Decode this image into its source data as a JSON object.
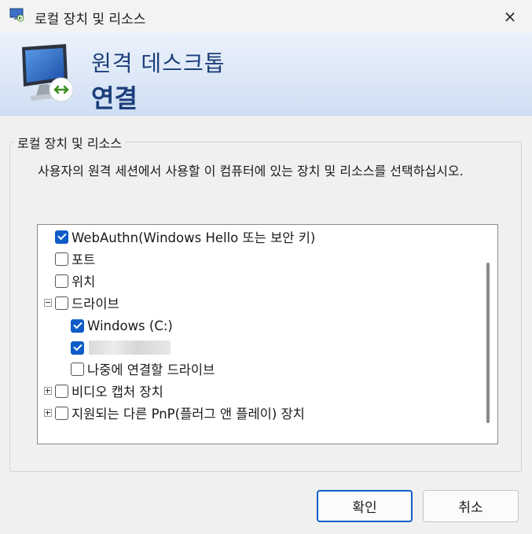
{
  "window": {
    "title": "로컬 장치 및 리소스",
    "close_icon": "×"
  },
  "banner": {
    "line1": "원격 데스크톱",
    "line2": "연결"
  },
  "group": {
    "label": "로컬 장치 및 리소스",
    "description": "사용자의 원격 세션에서 사용할 이 컴퓨터에 있는 장치 및 리소스를 선택하십시오."
  },
  "devices": {
    "webauthn": "WebAuthn(Windows Hello 또는 보안 키)",
    "ports": "포트",
    "location": "위치",
    "drives": "드라이브",
    "drive_c": "Windows (C:)",
    "later_drives": "나중에 연결할 드라이브",
    "video_capture": "비디오 캡처 장치",
    "pnp": "지원되는 다른 PnP(플러그 앤 플레이) 장치"
  },
  "buttons": {
    "ok": "확인",
    "cancel": "취소"
  },
  "colors": {
    "accent": "#0f5cc7",
    "banner_text": "#1c3f7a"
  }
}
